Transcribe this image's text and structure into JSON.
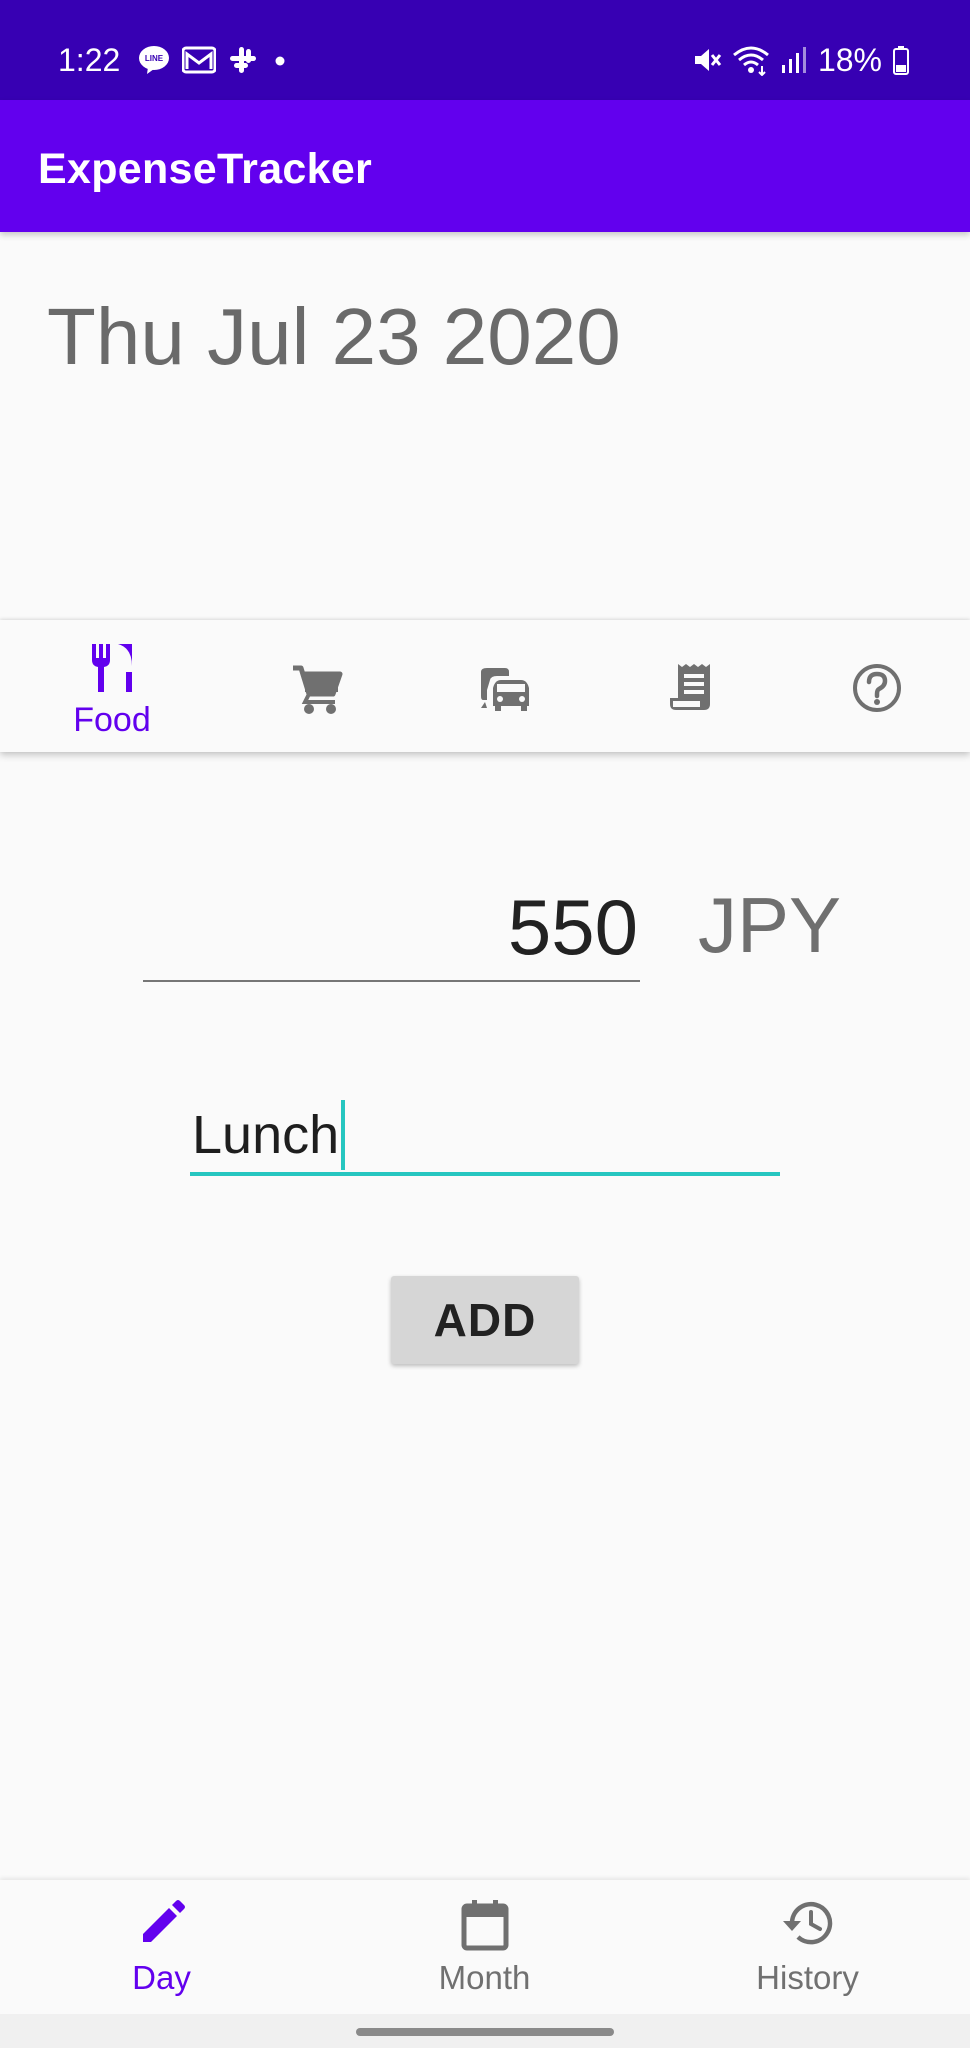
{
  "status_bar": {
    "time": "1:22",
    "battery": "18%",
    "left_icons": [
      "line-chat-icon",
      "mail-icon",
      "slack-icon",
      "dot-icon"
    ],
    "right_icons": [
      "mute-icon",
      "wifi-icon",
      "signal-icon",
      "battery-icon"
    ]
  },
  "app_bar": {
    "title": "ExpenseTracker",
    "color": "#6200ee"
  },
  "date": "Thu Jul 23 2020",
  "categories": [
    {
      "label": "Food",
      "icon": "restaurant-icon",
      "selected": true
    },
    {
      "label": "",
      "icon": "shopping-cart-icon",
      "selected": false
    },
    {
      "label": "",
      "icon": "transport-icon",
      "selected": false
    },
    {
      "label": "",
      "icon": "receipt-icon",
      "selected": false
    },
    {
      "label": "",
      "icon": "help-icon",
      "selected": false
    }
  ],
  "form": {
    "amount": "550",
    "currency": "JPY",
    "description": "Lunch",
    "add_label": "ADD"
  },
  "bottom_nav": {
    "items": [
      {
        "label": "Day",
        "icon": "edit-icon",
        "selected": true
      },
      {
        "label": "Month",
        "icon": "calendar-icon",
        "selected": false
      },
      {
        "label": "History",
        "icon": "history-icon",
        "selected": false
      }
    ]
  },
  "colors": {
    "status_bar": "#3700b3",
    "primary": "#6200ee",
    "accent": "#26c6c0",
    "icon_inactive": "#707070"
  }
}
